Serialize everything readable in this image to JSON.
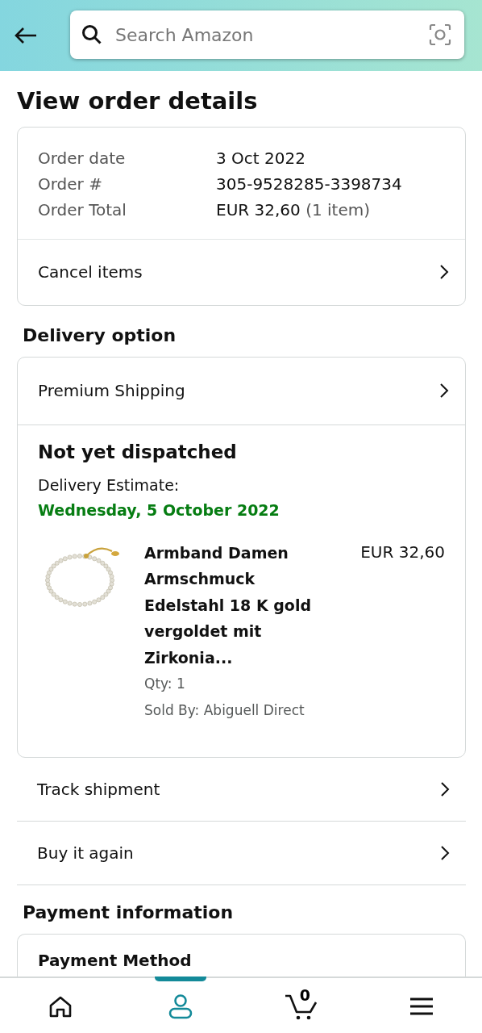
{
  "header": {
    "search": {
      "placeholder": "Search Amazon"
    }
  },
  "title": "View order details",
  "order_summary": {
    "fields": [
      {
        "label": "Order date",
        "value": "3 Oct 2022"
      },
      {
        "label": "Order #",
        "value": "305-9528285-3398734"
      },
      {
        "label": "Order Total",
        "value": "EUR 32,60",
        "note": "(1 item)"
      }
    ],
    "action": "Cancel items"
  },
  "delivery": {
    "heading": "Delivery option",
    "option": "Premium Shipping",
    "status": "Not yet dispatched",
    "estimate_label": "Delivery Estimate:",
    "estimate_date": "Wednesday, 5 October 2022",
    "item": {
      "name": "Armband Damen Armschmuck Edelstahl 18 K gold vergoldet mit Zirkonia...",
      "price": "EUR 32,60",
      "qty": "Qty: 1",
      "seller": "Sold By: Abiguell Direct"
    }
  },
  "actions": [
    "Track shipment",
    "Buy it again"
  ],
  "payment": {
    "heading": "Payment information",
    "method_label": "Payment Method"
  },
  "bottom_nav": [
    {
      "kind": "home",
      "selected": false
    },
    {
      "kind": "account",
      "selected": true
    },
    {
      "kind": "cart",
      "selected": false,
      "count": "0"
    },
    {
      "kind": "menu",
      "selected": false
    }
  ]
}
